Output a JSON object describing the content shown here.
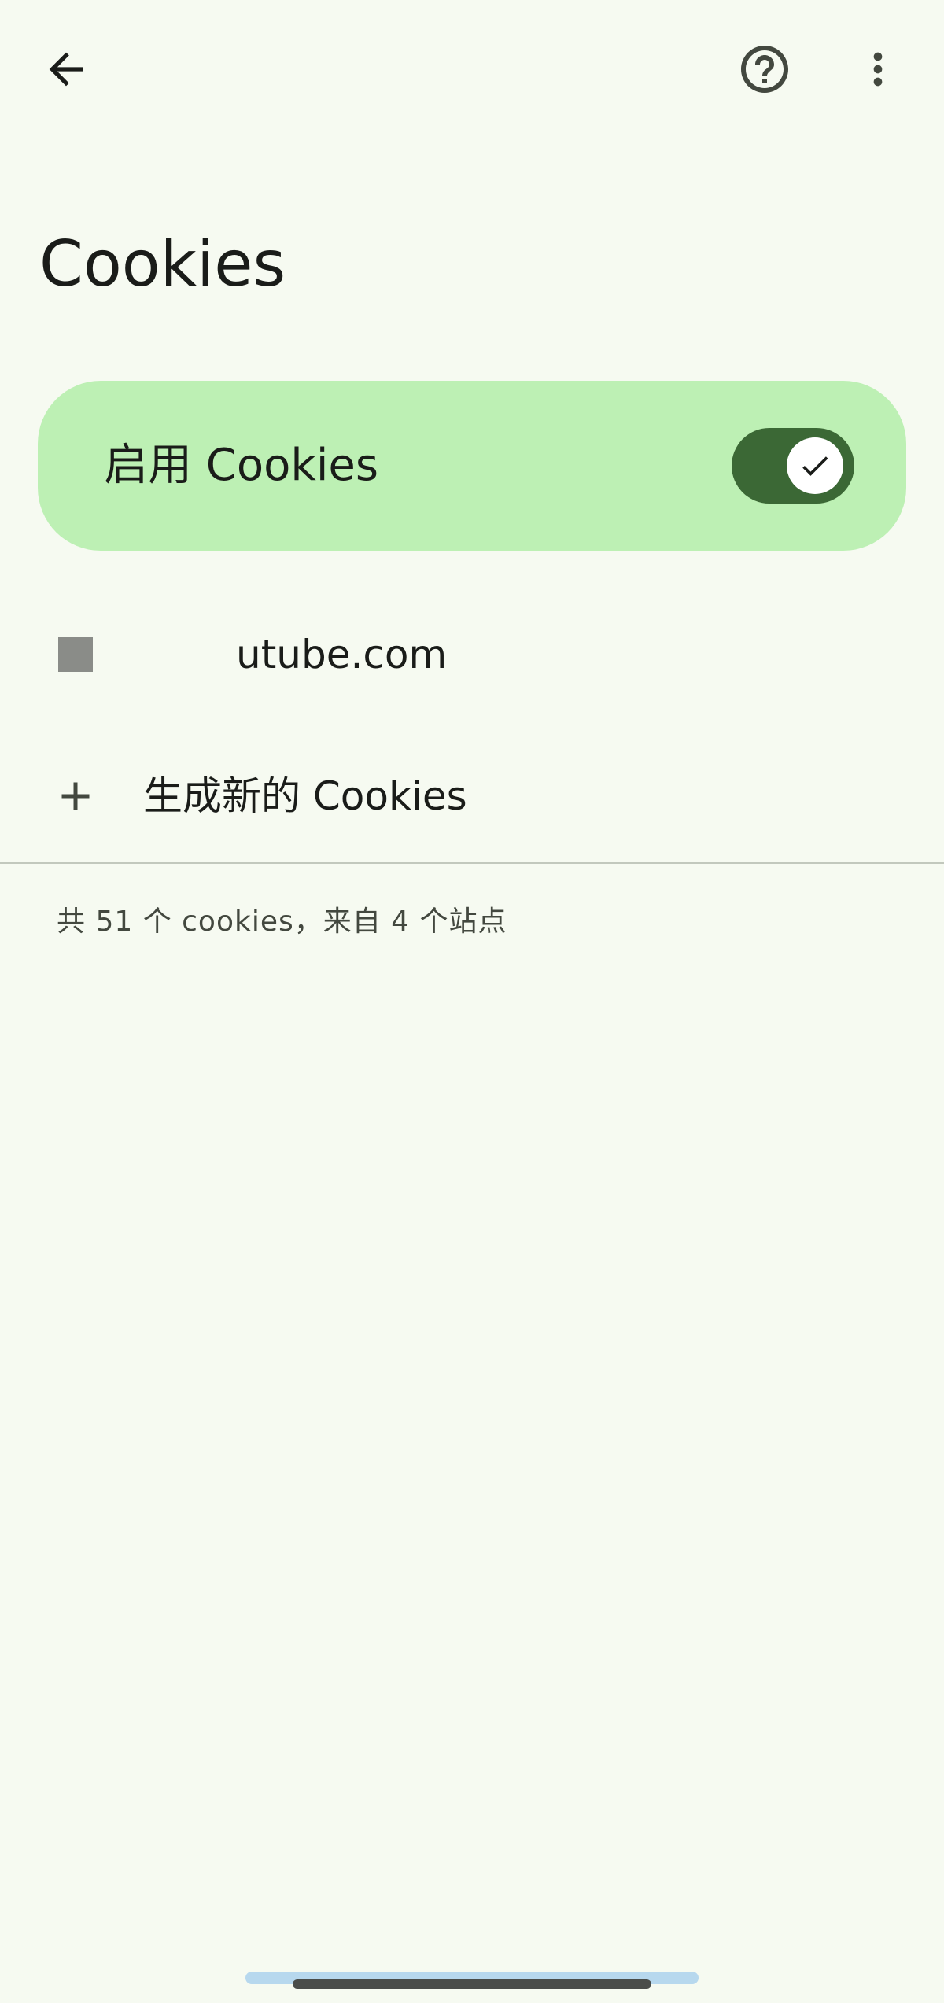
{
  "page": {
    "title": "Cookies"
  },
  "toolbar": {
    "back_icon": "arrow-left-icon",
    "help_icon": "help-circle-icon",
    "more_icon": "more-vertical-icon"
  },
  "toggle": {
    "label": "启用 Cookies",
    "enabled": true,
    "check_icon": "check-icon"
  },
  "sites": [
    {
      "name": "utube.com",
      "icon": "site-favicon"
    }
  ],
  "add": {
    "label": "生成新的 Cookies",
    "icon": "plus-icon"
  },
  "summary": {
    "text": "共 51 个 cookies，来自 4 个站点"
  },
  "colors": {
    "background": "#f6faf1",
    "card": "#bdf0b4",
    "switch_track": "#3b6835",
    "text": "#1a1c19",
    "secondary_text": "#43483f"
  }
}
